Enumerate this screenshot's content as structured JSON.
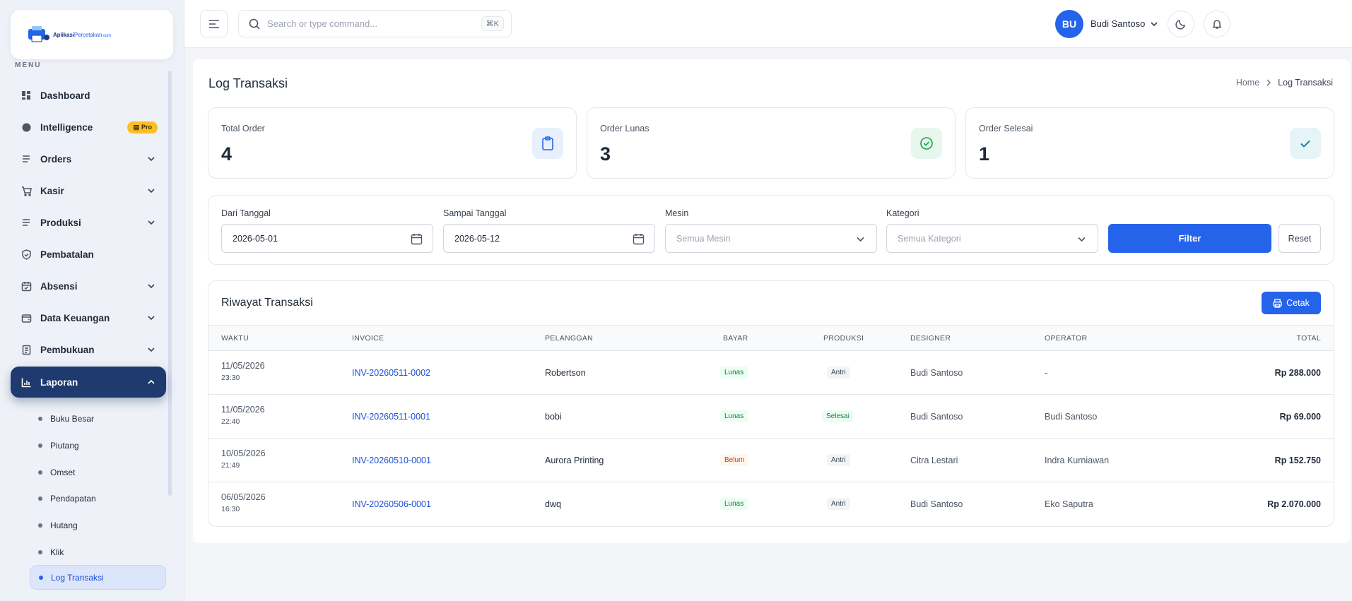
{
  "brand": {
    "name_a": "Aplikasi",
    "name_b": "Percetakan",
    "name_c": ".com"
  },
  "sidebar": {
    "menu_label": "MENU",
    "items": [
      {
        "label": "Dashboard"
      },
      {
        "label": "Intelligence",
        "badge": "Pro"
      },
      {
        "label": "Orders"
      },
      {
        "label": "Kasir"
      },
      {
        "label": "Produksi"
      },
      {
        "label": "Pembatalan"
      },
      {
        "label": "Absensi"
      },
      {
        "label": "Data Keuangan"
      },
      {
        "label": "Pembukuan"
      },
      {
        "label": "Laporan"
      }
    ],
    "sub_items": [
      {
        "label": "Buku Besar"
      },
      {
        "label": "Piutang"
      },
      {
        "label": "Omset"
      },
      {
        "label": "Pendapatan"
      },
      {
        "label": "Hutang"
      },
      {
        "label": "Klik"
      },
      {
        "label": "Log Transaksi"
      }
    ]
  },
  "header": {
    "search_placeholder": "Search or type command...",
    "shortcut": "⌘K",
    "avatar_initials": "BU",
    "user_name": "Budi Santoso"
  },
  "page": {
    "title": "Log Transaksi",
    "breadcrumb": {
      "home": "Home",
      "current": "Log Transaksi"
    }
  },
  "stats": [
    {
      "label": "Total Order",
      "value": "4"
    },
    {
      "label": "Order Lunas",
      "value": "3"
    },
    {
      "label": "Order Selesai",
      "value": "1"
    }
  ],
  "filters": {
    "from_label": "Dari Tanggal",
    "from_value": "2026-05-01",
    "to_label": "Sampai Tanggal",
    "to_value": "2026-05-12",
    "machine_label": "Mesin",
    "machine_value": "Semua Mesin",
    "category_label": "Kategori",
    "category_value": "Semua Kategori",
    "filter_button": "Filter",
    "reset_button": "Reset"
  },
  "table": {
    "title": "Riwayat Transaksi",
    "print_button": "Cetak",
    "columns": [
      "WAKTU",
      "INVOICE",
      "PELANGGAN",
      "BAYAR",
      "PRODUKSI",
      "DESIGNER",
      "OPERATOR",
      "TOTAL"
    ],
    "rows": [
      {
        "date": "11/05/2026",
        "time": "23:30",
        "invoice": "INV-20260511-0002",
        "customer": "Robertson",
        "payment": "Lunas",
        "production": "Antri",
        "designer": "Budi Santoso",
        "operator": "-",
        "total": "Rp 288.000"
      },
      {
        "date": "11/05/2026",
        "time": "22:40",
        "invoice": "INV-20260511-0001",
        "customer": "bobi",
        "payment": "Lunas",
        "production": "Selesai",
        "designer": "Budi Santoso",
        "operator": "Budi Santoso",
        "total": "Rp 69.000"
      },
      {
        "date": "10/05/2026",
        "time": "21:49",
        "invoice": "INV-20260510-0001",
        "customer": "Aurora Printing",
        "payment": "Belum",
        "production": "Antri",
        "designer": "Citra Lestari",
        "operator": "Indra Kurniawan",
        "total": "Rp 152.750"
      },
      {
        "date": "06/05/2026",
        "time": "16:30",
        "invoice": "INV-20260506-0001",
        "customer": "dwq",
        "payment": "Lunas",
        "production": "Antri",
        "designer": "Budi Santoso",
        "operator": "Eko Saputra",
        "total": "Rp 2.070.000"
      }
    ]
  },
  "colors": {
    "primary": "#2563eb",
    "sidebar_active": "#1e3a6e",
    "success": "#15803d",
    "warning": "#c2410c"
  }
}
